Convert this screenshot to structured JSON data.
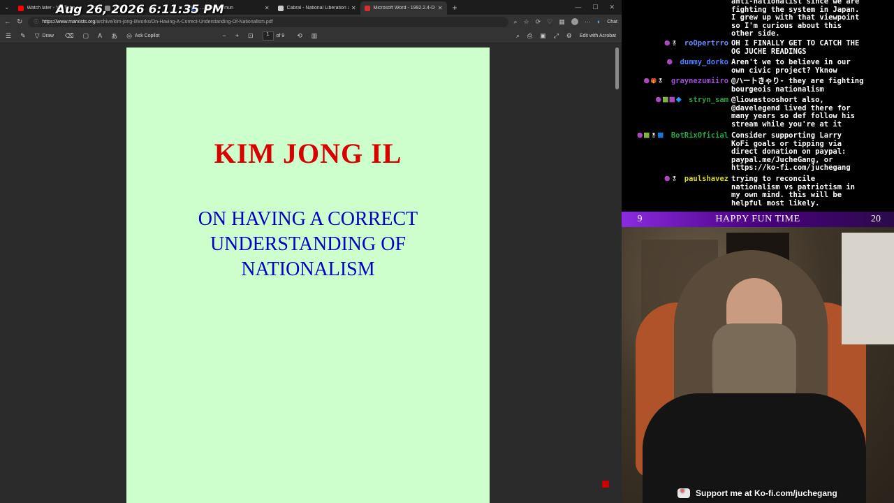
{
  "overlay": {
    "clock": "Aug 26, 2026 6:11:35 PM"
  },
  "browser": {
    "tabs": [
      {
        "title": "Watch later - YouTube",
        "color": "#ff0000",
        "active": false
      },
      {
        "title": "Wik",
        "color": "#888888",
        "active": false
      },
      {
        "title": "...new commun",
        "color": "#3b82f6",
        "active": false
      },
      {
        "title": "Cabral - National Liberation and C",
        "color": "#cccccc",
        "active": false
      },
      {
        "title": "Microsoft Word - 1992.2.4-D6.doc",
        "color": "#d32f2f",
        "active": true
      }
    ],
    "new_tab": "+",
    "url_host": "https://www.marxists.org",
    "url_path": "/archive/kim-jong-il/works/On-Having-A-Correct-Understanding-Of-Nationalism.pdf",
    "chat_label": "Chat"
  },
  "pdf_toolbar": {
    "draw": "Draw",
    "ask_copilot": "Ask Copilot",
    "page_current": "1",
    "page_total": "of 9",
    "edit_acrobat": "Edit with Acrobat"
  },
  "document": {
    "author": "KIM JONG IL",
    "title": "ON HAVING A CORRECT UNDERSTANDING OF NATIONALISM"
  },
  "chat": {
    "messages": [
      {
        "badges": "",
        "user": "",
        "user_color": "#ffffff",
        "text": "anti-nationalist since we are\nfighting the system in Japan.\nI grew up with that viewpoint\nso I'm curious about this\nother side."
      },
      {
        "badges": "🟣🎖",
        "user": "roOpertrro",
        "user_color": "#6a8cff",
        "text": "OH I FINALLY GET TO CATCH THE\nOG JUCHE READINGS"
      },
      {
        "badges": "🟣",
        "user": "dummy_dorko",
        "user_color": "#4d7dff",
        "text": "Aren't we to believe in our\nown civic project? Yknow"
      },
      {
        "badges": "🟣🎁🎖",
        "user": "graynezumiiro",
        "user_color": "#a24ce0",
        "text": "@ハートきゃり- they are fighting\nbourgeois nationalism"
      },
      {
        "badges": "🟣🟩🟪🔷",
        "user": "stryn_sam",
        "user_color": "#2ea043",
        "text": "@liowastooshort also,\n@davelegend lived there for\nmany years so def follow his\nstream while you're at it"
      },
      {
        "badges": "🟣🟩🎖🟦",
        "user": "BotRixOficial",
        "user_color": "#22aa44",
        "text": "Consider supporting Larry\nKoFi goals or tipping via\ndirect donation on paypal:\npaypal.me/JucheGang, or\nhttps://ko-fi.com/juchegang"
      },
      {
        "badges": "🟣🎖",
        "user": "paulshavez",
        "user_color": "#d6d61a",
        "text": "trying to reconcile\nnationalism vs patriotism in\nmy own mind. this will be\nhelpful most likely."
      }
    ]
  },
  "webcam": {
    "left_number": "9",
    "title": "HAPPY FUN TIME",
    "right_number": "20",
    "support_text": "Support me at Ko-fi.com/juchegang"
  }
}
